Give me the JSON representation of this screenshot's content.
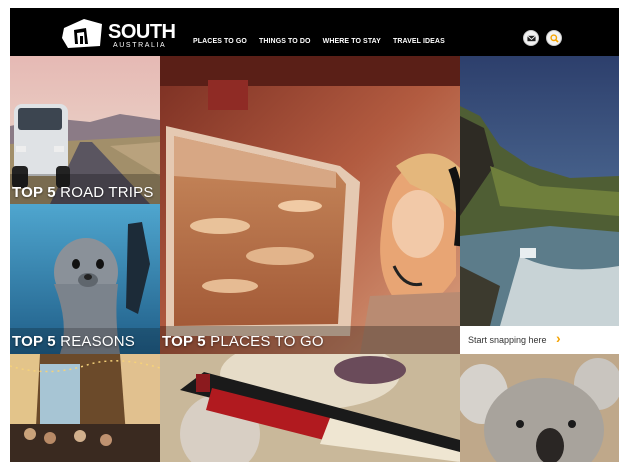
{
  "header": {
    "logo_word": "SOUTH",
    "logo_sub": "AUSTRALIA",
    "nav": [
      "PLACES TO GO",
      "THINGS TO DO",
      "WHERE TO STAY",
      "TRAVEL IDEAS"
    ],
    "icons": [
      "mail-icon",
      "search-icon"
    ],
    "accent": "#f5a300"
  },
  "tiles": {
    "road_trips": {
      "bold": "TOP 5",
      "rest": " ROAD TRIPS"
    },
    "reasons": {
      "bold": "TOP 5",
      "rest": " REASONS"
    },
    "places": {
      "bold": "TOP 5",
      "rest": " PLACES TO GO"
    }
  },
  "cta": {
    "label": "Start snapping here",
    "chevron": "›"
  }
}
